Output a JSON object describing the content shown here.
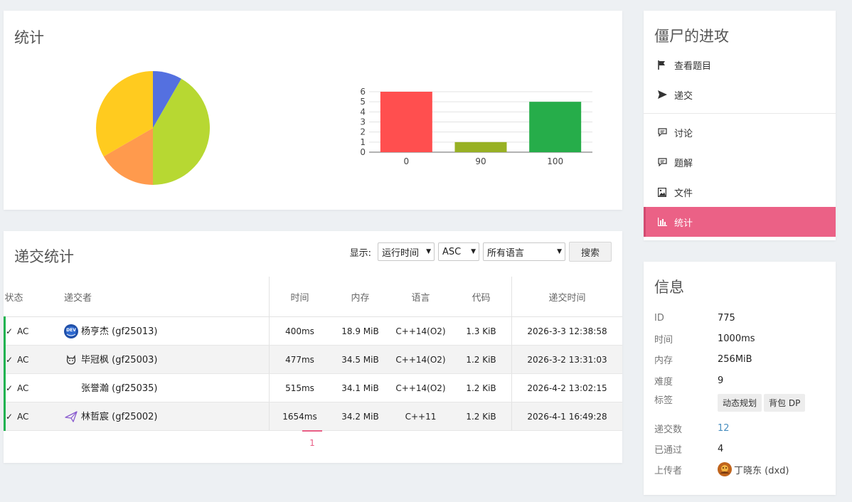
{
  "stats": {
    "title": "统计",
    "pie": {
      "colors": [
        "#5470e0",
        "#b7d832",
        "#ff9a4d",
        "#ffcb1f"
      ],
      "values": [
        1,
        5,
        2,
        4
      ]
    },
    "chart_data": {
      "type": "bar",
      "categories": [
        "0",
        "90",
        "100"
      ],
      "values": [
        6,
        1,
        5
      ],
      "colors": [
        "#ff4f4f",
        "#98b124",
        "#26ad4a"
      ],
      "ylim": [
        0,
        6
      ],
      "yticks": [
        "0",
        "1",
        "2",
        "3",
        "4",
        "5",
        "6"
      ]
    }
  },
  "submissions": {
    "title": "递交统计",
    "filter_label": "显示:",
    "sort_field": "运行时间",
    "sort_order": "ASC",
    "language": "所有语言",
    "search_button": "搜索",
    "headers": {
      "status": "状态",
      "user": "递交者",
      "time": "时间",
      "memory": "内存",
      "language": "语言",
      "code": "代码",
      "submit_time": "递交时间"
    },
    "rows": [
      {
        "status": "AC",
        "user": "杨亨杰 (gf25013)",
        "avatar": "dev-avatar-icon",
        "time": "400ms",
        "memory": "18.9 MiB",
        "lang": "C++14(O2)",
        "code": "1.3 KiB",
        "submitted": "2026-3-3 12:38:58"
      },
      {
        "status": "AC",
        "user": "毕冠枫 (gf25003)",
        "avatar": "cat-avatar-icon",
        "time": "477ms",
        "memory": "34.5 MiB",
        "lang": "C++14(O2)",
        "code": "1.2 KiB",
        "submitted": "2026-3-2 13:31:03"
      },
      {
        "status": "AC",
        "user": "张誉瀚 (gf25035)",
        "avatar": "",
        "time": "515ms",
        "memory": "34.1 MiB",
        "lang": "C++14(O2)",
        "code": "1.2 KiB",
        "submitted": "2026-4-2 13:02:15"
      },
      {
        "status": "AC",
        "user": "林哲宸 (gf25002)",
        "avatar": "paper-plane-avatar-icon",
        "time": "1654ms",
        "memory": "34.2 MiB",
        "lang": "C++11",
        "code": "1.2 KiB",
        "submitted": "2026-4-1 16:49:28"
      }
    ],
    "pagination": {
      "current": "1"
    }
  },
  "nav": {
    "title": "僵尸的进攻",
    "items": [
      {
        "label": "查看题目",
        "icon": "flag-icon"
      },
      {
        "label": "递交",
        "icon": "send-icon"
      },
      {
        "label": "讨论",
        "icon": "comment-icon"
      },
      {
        "label": "题解",
        "icon": "solution-icon"
      },
      {
        "label": "文件",
        "icon": "image-file-icon"
      },
      {
        "label": "统计",
        "icon": "bar-chart-icon"
      }
    ]
  },
  "info": {
    "title": "信息",
    "id_label": "ID",
    "id_value": "775",
    "time_label": "时间",
    "time_value": "1000ms",
    "memory_label": "内存",
    "memory_value": "256MiB",
    "difficulty_label": "难度",
    "difficulty_value": "9",
    "tags_label": "标签",
    "tags": [
      "动态规划",
      "背包 DP"
    ],
    "submissions_label": "递交数",
    "submissions_value": "12",
    "accepted_label": "已通过",
    "accepted_value": "4",
    "uploader_label": "上传者",
    "uploader_value": "丁晓东 (dxd)"
  }
}
